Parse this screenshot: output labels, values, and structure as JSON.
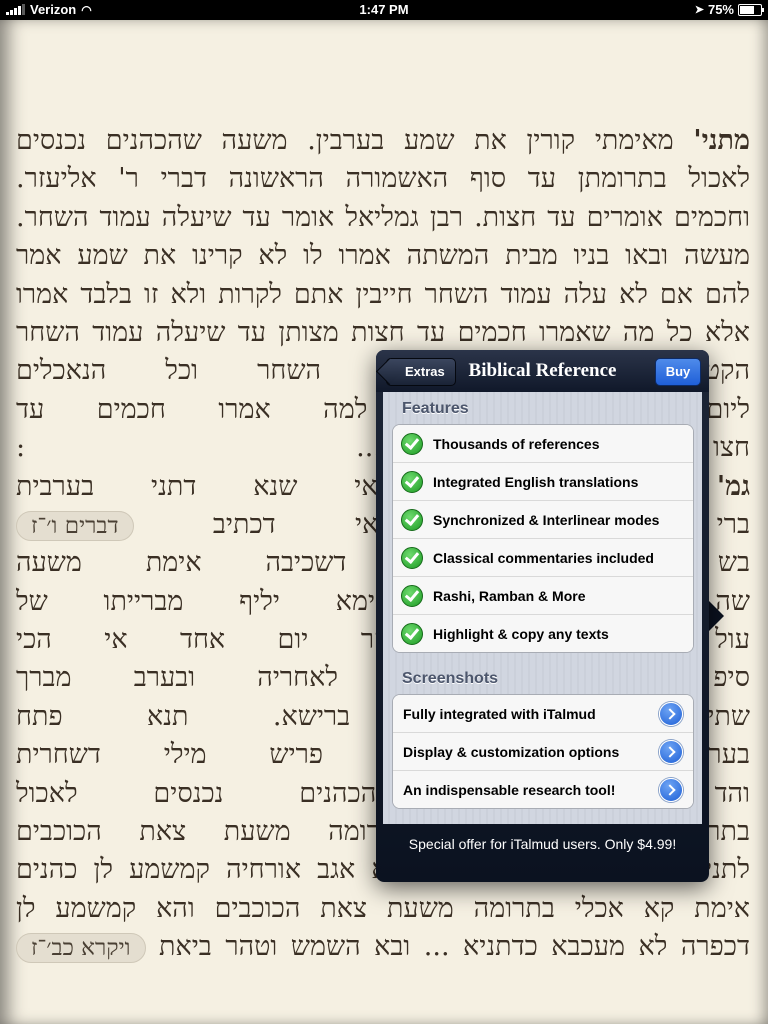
{
  "status": {
    "carrier": "Verizon",
    "time": "1:47 PM",
    "battery": "75%",
    "battery_level": 0.75
  },
  "text": {
    "lines": [
      [
        "מתני'",
        " מאימתי קורין את שמע בערבין. משעה שהכהנים נכנסים"
      ],
      [
        "",
        "לאכול בתרומתן עד סוף האשמורה הראשונה דברי ר' אליעזר."
      ],
      [
        "",
        "וחכמים אומרים עד חצות. רבן גמליאל אומר עד שיעלה עמוד השחר."
      ],
      [
        "",
        "מעשה ובאו בניו מבית המשתה אמרו לו לא קרינו את שמע אמר"
      ],
      [
        "",
        "להם אם לא עלה עמוד השחר חייבין אתם לקרות ולא זו בלבד אמרו"
      ],
      [
        "",
        "אלא כל מה שאמרו חכמים עד חצות מצותן עד שיעלה עמוד השחר"
      ],
      [
        "",
        "הקט ... שיעלה עמוד השחר וכל הנאכלים"
      ],
      [
        "",
        "ליום ... השחר א״כ למה אמרו חכמים עד"
      ],
      [
        "",
        "חצו ... :"
      ],
      [
        "גמ'",
        " ... מתי ותו מאי שנא דתני בערבית"
      ],
      [
        "",
        "ברי ... אקרא קאי דכתיב"
      ],
      [
        "",
        "בש ... יאת שמע דשכיבה אימת משעה"
      ],
      [
        "",
        "שה ... אי בעית אימא יליף מברייתו של"
      ],
      [
        "",
        "עול ... ערב ויהי בקר יום אחד אי הכי"
      ],
      [
        "",
        "סיפ ... פניה ואחת לאחריה ובערב מברך"
      ],
      [
        "",
        "שתי ... דערבית ברישא. תנא פתח"
      ],
      [
        "",
        "בער ... אי בשחרית פריש מילי דשחרית"
      ],
      [
        "",
        "והד ... משעה שהכהנים נכנסים לאכול"
      ],
      [
        "",
        "בתרומתן מאי ... אכלי תרומה משעת צאת הכוכבים"
      ],
      [
        "",
        "לתני משעת צאת הכוכבים. מלתא אגב אורחיה קמשמע לן כהנים"
      ],
      [
        "",
        "אימת קא אכלי בתרומה משעת צאת הכוכבים והא קמשמע לן"
      ],
      [
        "",
        "דכפרה לא מעכבא כדתניא ... ובא השמש וטהר ביאת"
      ]
    ],
    "ref1": "דברים ו׳־ז",
    "ref2": "ויקרא כב׳־ז"
  },
  "popover": {
    "back_label": "Extras",
    "title": "Biblical Reference",
    "buy_label": "Buy",
    "features_title": "Features",
    "features": [
      "Thousands of references",
      "Integrated English translations",
      "Synchronized & Interlinear modes",
      "Classical commentaries included",
      "Rashi, Ramban & More",
      "Highlight & copy any texts"
    ],
    "screenshots_title": "Screenshots",
    "screenshots": [
      "Fully integrated with iTalmud",
      "Display & customization options",
      "An indispensable research tool!"
    ],
    "footer": "Special offer for iTalmud users. Only $4.99!"
  }
}
